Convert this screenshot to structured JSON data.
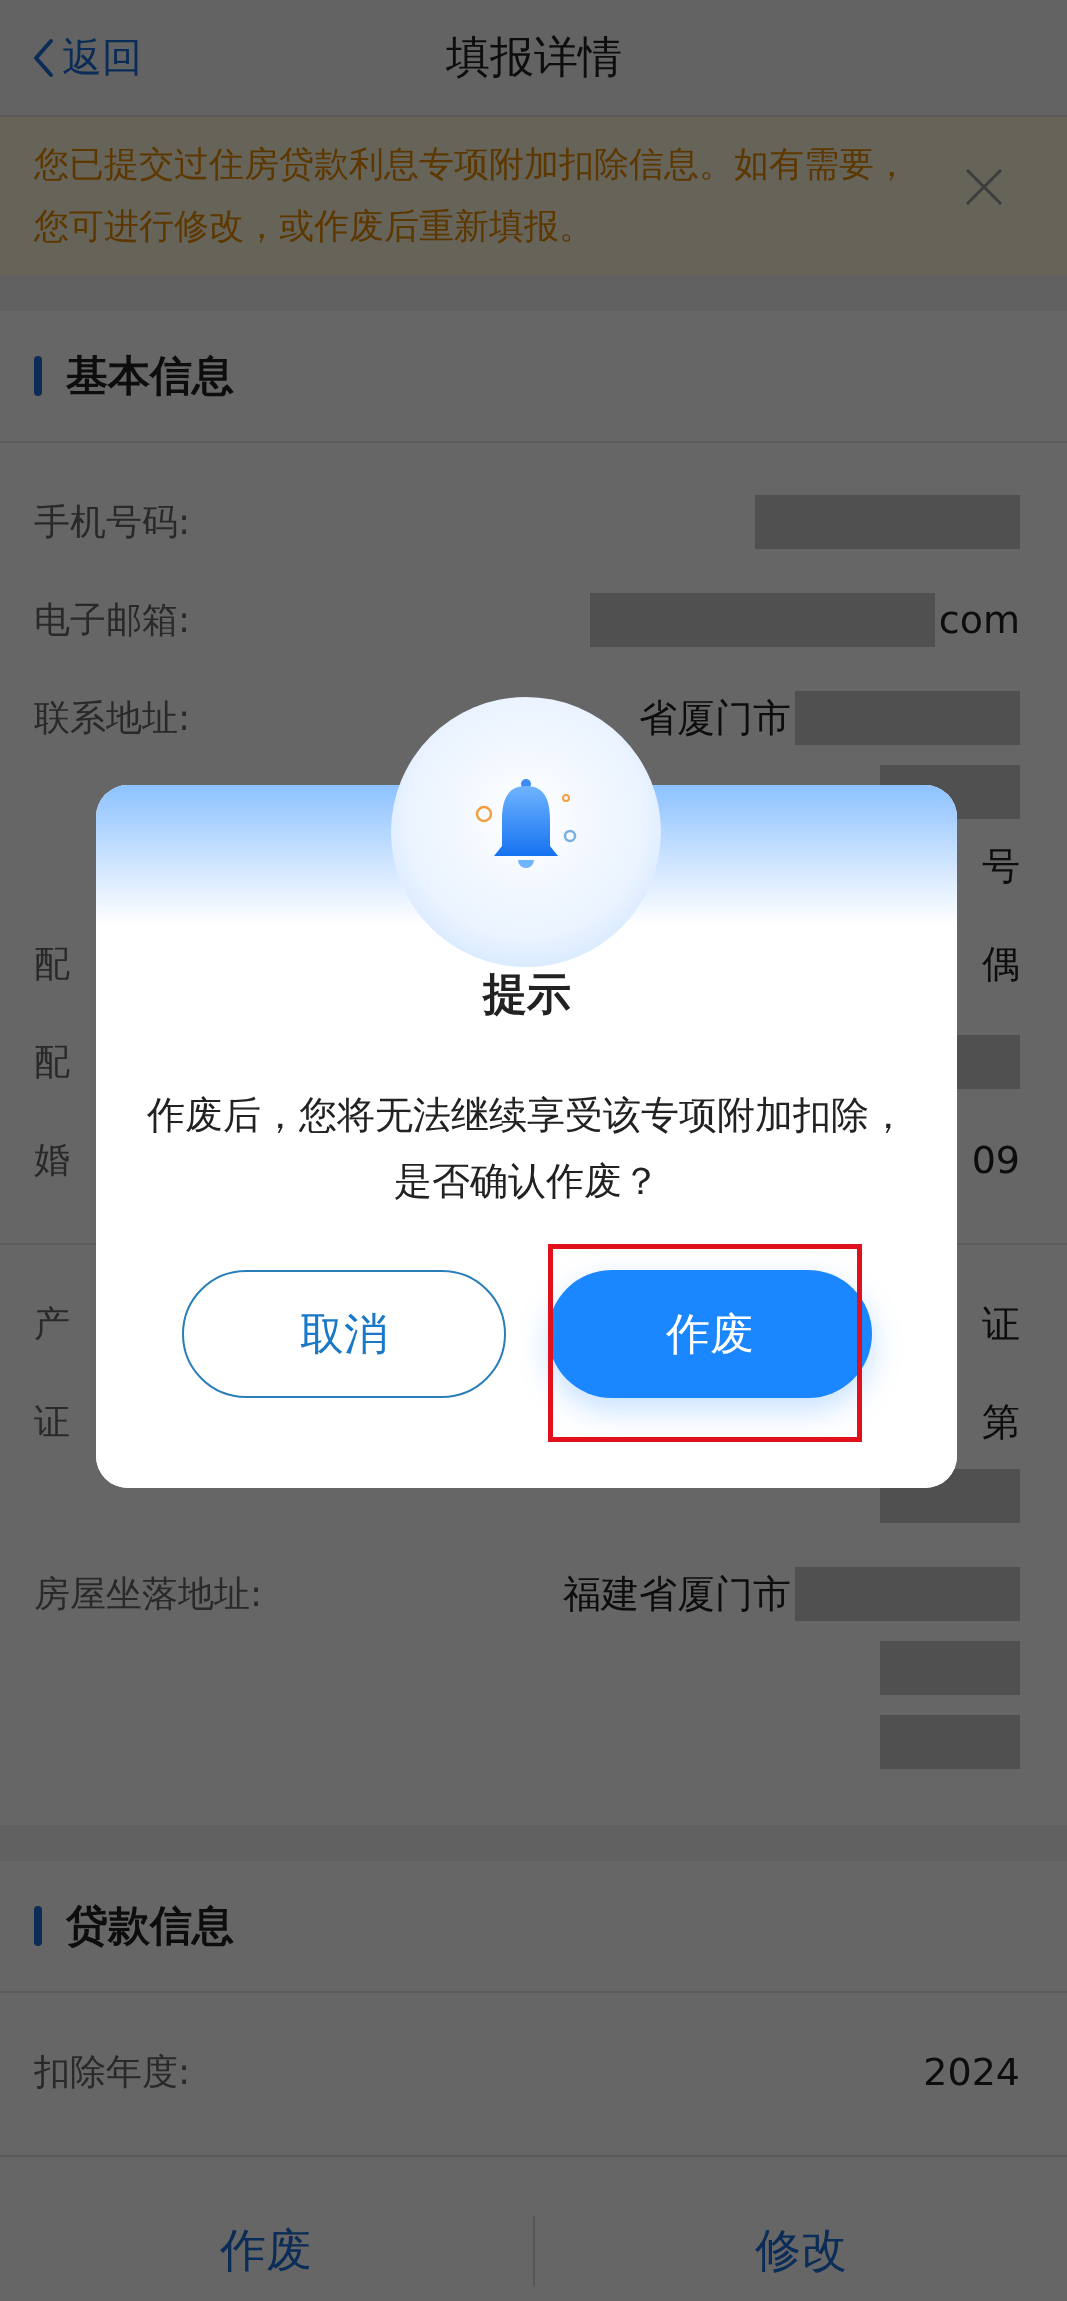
{
  "nav": {
    "back_label": "返回",
    "title": "填报详情"
  },
  "notice": {
    "text": "您已提交过住房贷款利息专项附加扣除信息。如有需要，您可进行修改，或作废后重新填报。"
  },
  "sections": [
    {
      "title": "基本信息",
      "groups": [
        [
          {
            "label": "手机号码:",
            "lines": [
              [
                {
                  "kind": "redacted"
                }
              ]
            ]
          },
          {
            "label": "电子邮箱:",
            "lines": [
              [
                {
                  "kind": "redacted"
                },
                {
                  "kind": "text",
                  "text": "com"
                }
              ]
            ]
          },
          {
            "label": "联系地址:",
            "lines": [
              [
                {
                  "kind": "text",
                  "text": "省厦门市"
                },
                {
                  "kind": "redacted"
                }
              ],
              [
                {
                  "kind": "redacted"
                }
              ],
              [
                {
                  "kind": "text",
                  "text": "号"
                }
              ]
            ]
          },
          {
            "label": "配",
            "lines": [
              [
                {
                  "kind": "text",
                  "text": "偶"
                }
              ]
            ]
          },
          {
            "label": "配",
            "lines": [
              [
                {
                  "kind": "redacted"
                }
              ]
            ]
          },
          {
            "label": "婚",
            "lines": [
              [
                {
                  "kind": "text",
                  "text": "09"
                }
              ]
            ]
          }
        ],
        [
          {
            "label": "产",
            "lines": [
              [
                {
                  "kind": "text",
                  "text": "证"
                }
              ]
            ]
          },
          {
            "label": "证",
            "lines": [
              [
                {
                  "kind": "text",
                  "text": "第"
                }
              ],
              [
                {
                  "kind": "redacted"
                }
              ]
            ]
          },
          {
            "label": "房屋坐落地址:",
            "lines": [
              [
                {
                  "kind": "text",
                  "text": "福建省厦门市"
                },
                {
                  "kind": "redacted"
                }
              ],
              [
                {
                  "kind": "redacted"
                }
              ],
              [
                {
                  "kind": "redacted"
                }
              ]
            ]
          }
        ]
      ]
    },
    {
      "title": "贷款信息",
      "groups": [
        [
          {
            "label": "扣除年度:",
            "lines": [
              [
                {
                  "kind": "text",
                  "text": "2024"
                }
              ]
            ]
          }
        ]
      ]
    }
  ],
  "bottom_actions": [
    "作废",
    "修改"
  ],
  "dialog": {
    "title": "提示",
    "message": "作废后，您将无法继续享受该专项附加扣除，是否确认作废？",
    "buttons": [
      {
        "label": "取消",
        "kind": "secondary",
        "highlighted": false
      },
      {
        "label": "作废",
        "kind": "primary",
        "highlighted": true
      }
    ]
  }
}
